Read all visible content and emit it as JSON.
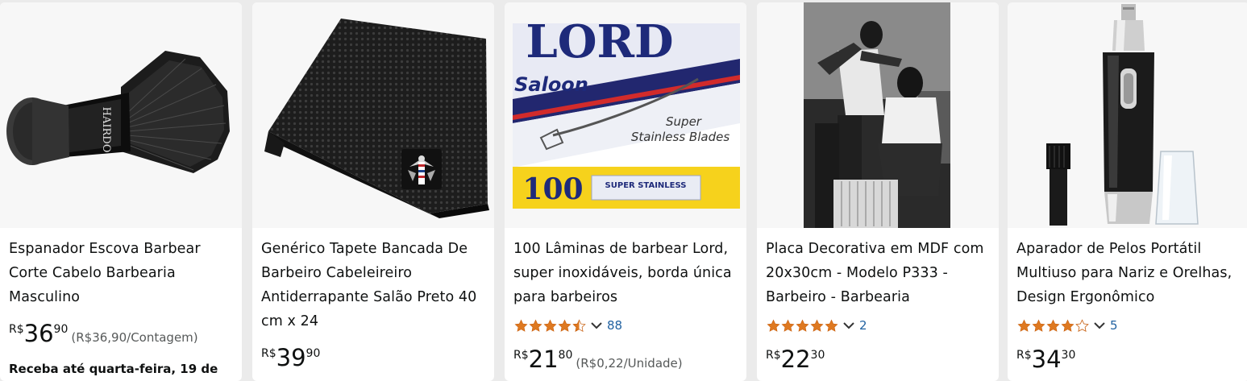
{
  "products": [
    {
      "title": "Espanador Escova Barbear Corte Cabelo Barbearia Masculino",
      "currency": "R$",
      "price_whole": "36",
      "price_fraction": "90",
      "unit_price": "(R$36,90/Contagem)",
      "delivery_prefix": "Receba até ",
      "delivery_date": "quarta-feira, 19 de",
      "image_icon": "neck-duster-brush-image",
      "image_brand_text": "HAIRDO"
    },
    {
      "title": "Genérico Tapete Bancada De Barbeiro Cabeleireiro Antiderrapante Salão Preto 40 cm x 24",
      "currency": "R$",
      "price_whole": "39",
      "price_fraction": "90",
      "image_icon": "barber-mat-image"
    },
    {
      "title": "100 Lâminas de barbear Lord, super inoxidáveis, borda única para barbeiros",
      "rating": 4.5,
      "rating_count": "88",
      "currency": "R$",
      "price_whole": "21",
      "price_fraction": "80",
      "unit_price": "(R$0,22/Unidade)",
      "image_icon": "razor-blades-box-image",
      "box_brand": "LORD",
      "box_line": "Saloon",
      "box_text_1": "Super",
      "box_text_2": "Stainless Blades",
      "box_count": "100",
      "box_blade_text": "SUPER STAINLESS"
    },
    {
      "title": "Placa Decorativa em MDF com 20x30cm - Modelo P333 - Barbeiro - Barbearia",
      "rating": 5,
      "rating_count": "2",
      "currency": "R$",
      "price_whole": "22",
      "price_fraction": "30",
      "image_icon": "vintage-barber-photo-image"
    },
    {
      "title": "Aparador de Pelos Portátil Multiuso para Nariz e Orelhas, Design Ergonômico",
      "rating": 4,
      "rating_count": "5",
      "currency": "R$",
      "price_whole": "34",
      "price_fraction": "30",
      "image_icon": "nose-trimmer-image"
    }
  ],
  "colors": {
    "star": "#de7921",
    "link": "#2162a1",
    "card_bg": "#ffffff",
    "page_bg": "#ebebeb"
  }
}
